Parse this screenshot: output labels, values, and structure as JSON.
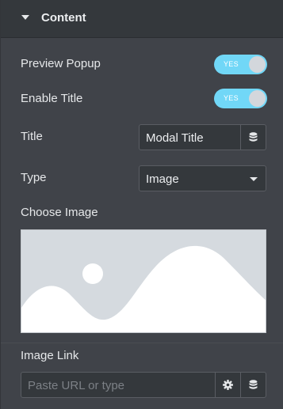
{
  "section": {
    "title": "Content"
  },
  "preview_popup": {
    "label": "Preview Popup",
    "toggle_text": "YES",
    "enabled": true
  },
  "enable_title": {
    "label": "Enable Title",
    "toggle_text": "YES",
    "enabled": true
  },
  "title_field": {
    "label": "Title",
    "value": "Modal Title"
  },
  "type_field": {
    "label": "Type",
    "selected": "Image"
  },
  "choose_image": {
    "label": "Choose Image"
  },
  "image_link": {
    "label": "Image Link",
    "placeholder": "Paste URL or type"
  },
  "icons": {
    "collapse": "caret-down-icon",
    "dynamic": "database-icon",
    "settings": "gear-icon",
    "placeholder": "image-placeholder-icon"
  },
  "colors": {
    "panel_bg": "#404349",
    "header_bg": "#34383c",
    "toggle_on": "#71d7f7",
    "field_bg": "#34383c",
    "image_placeholder_bg": "#d5dadf"
  }
}
